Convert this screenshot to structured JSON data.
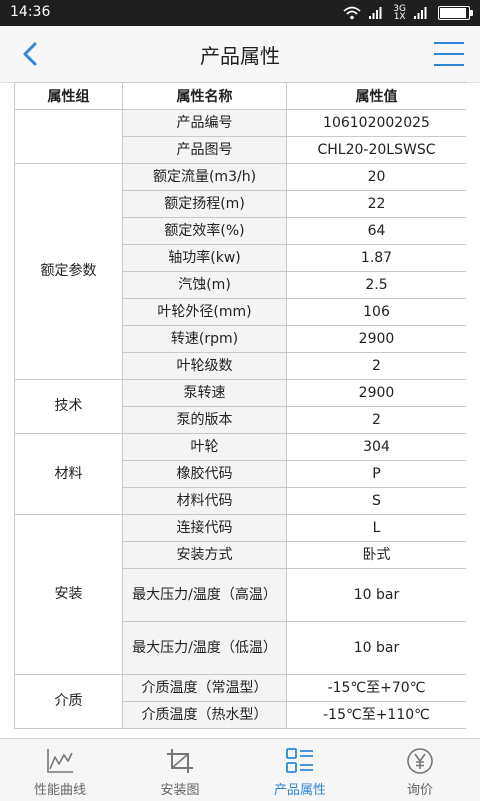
{
  "status": {
    "time": "14:36",
    "network": "3G\n1X"
  },
  "header": {
    "title": "产品属性"
  },
  "table": {
    "columns": [
      "属性组",
      "属性名称",
      "属性值"
    ],
    "groups": [
      {
        "group": "",
        "rows": [
          {
            "name": "产品编号",
            "value": "106102002025"
          },
          {
            "name": "产品图号",
            "value": "CHL20-20LSWSC"
          }
        ]
      },
      {
        "group": "额定参数",
        "rows": [
          {
            "name": "额定流量(m3/h)",
            "value": "20"
          },
          {
            "name": "额定扬程(m)",
            "value": "22"
          },
          {
            "name": "额定效率(%)",
            "value": "64"
          },
          {
            "name": "轴功率(kw)",
            "value": "1.87"
          },
          {
            "name": "汽蚀(m)",
            "value": "2.5"
          },
          {
            "name": "叶轮外径(mm)",
            "value": "106"
          },
          {
            "name": "转速(rpm)",
            "value": "2900"
          },
          {
            "name": "叶轮级数",
            "value": "2"
          }
        ]
      },
      {
        "group": "技术",
        "rows": [
          {
            "name": "泵转速",
            "value": "2900"
          },
          {
            "name": "泵的版本",
            "value": "2"
          }
        ]
      },
      {
        "group": "材料",
        "rows": [
          {
            "name": "叶轮",
            "value": "304"
          },
          {
            "name": "橡胶代码",
            "value": "P"
          },
          {
            "name": "材料代码",
            "value": "S"
          }
        ]
      },
      {
        "group": "安装",
        "rows": [
          {
            "name": "连接代码",
            "value": "L"
          },
          {
            "name": "安装方式",
            "value": "卧式"
          },
          {
            "name": "最大压力/温度（高温）",
            "value": "10 bar",
            "tall": true
          },
          {
            "name": "最大压力/温度（低温）",
            "value": "10 bar",
            "tall": true
          }
        ]
      },
      {
        "group": "介质",
        "rows": [
          {
            "name": "介质温度（常温型）",
            "value": "-15℃至+70℃"
          },
          {
            "name": "介质温度（热水型）",
            "value": "-15℃至+110℃"
          }
        ]
      }
    ]
  },
  "tabs": [
    {
      "label": "性能曲线",
      "icon": "chart-line-icon",
      "active": false
    },
    {
      "label": "安装图",
      "icon": "crop-icon",
      "active": false
    },
    {
      "label": "产品属性",
      "icon": "list-icon",
      "active": true
    },
    {
      "label": "询价",
      "icon": "yen-icon",
      "active": false
    }
  ],
  "colors": {
    "accent": "#2f86d8",
    "statusbar": "#1f1f1f"
  }
}
